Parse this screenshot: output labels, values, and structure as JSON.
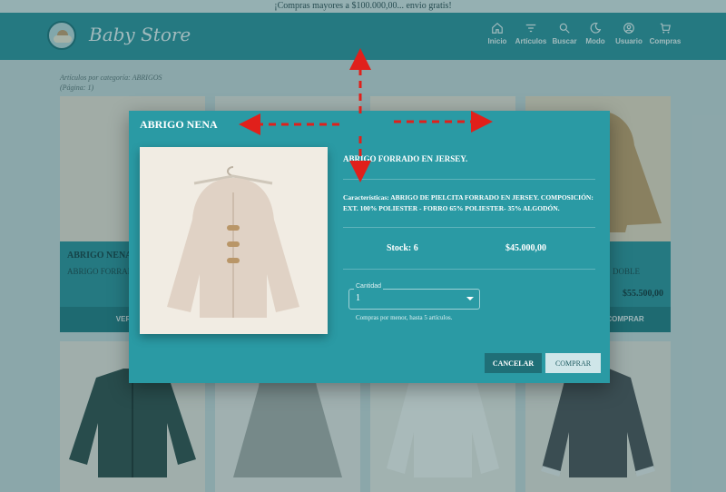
{
  "promo_banner": "¡Compras mayores a $100.000,00... envio gratis!",
  "brand": {
    "name": "Baby Store",
    "logo": "bear-cloud-logo"
  },
  "nav": [
    {
      "label": "Inicio",
      "icon": "home-icon"
    },
    {
      "label": "Artículos",
      "icon": "filter-icon"
    },
    {
      "label": "Buscar",
      "icon": "search-icon"
    },
    {
      "label": "Modo",
      "icon": "moon-icon"
    },
    {
      "label": "Usuario",
      "icon": "user-icon"
    },
    {
      "label": "Compras",
      "icon": "cart-icon"
    }
  ],
  "breadcrumb": {
    "category": "Artículos por categoría: ABRIGOS",
    "page": "(Página: 1)"
  },
  "cards": [
    {
      "title": "ABRIGO NENA",
      "subtitle": "ABRIGO FORRADO",
      "price": "",
      "button": "VER MÁS"
    },
    {
      "title": "",
      "subtitle": "",
      "price": "",
      "button": ""
    },
    {
      "title": "",
      "subtitle": "",
      "price": "",
      "button": ""
    },
    {
      "title": "",
      "subtitle": "DOBLE",
      "price": "$55.500,00",
      "button": "COMPRAR"
    }
  ],
  "modal": {
    "title": "ABRIGO NENA",
    "description": "ABRIGO FORRADO EN JERSEY.",
    "features": "Características: ABRIGO DE PIELCITA FORRADO EN JERSEY. COMPOSICIÓN: EXT. 100% POLIESTER - FORRO 65% POLIESTER- 35% ALGODÓN.",
    "stock": "Stock: 6",
    "price": "$45.000,00",
    "quantity": {
      "label": "Cantidad",
      "value": "1"
    },
    "helper": "Compras por menor, hasta 5 artículos.",
    "cancel_label": "CANCELAR",
    "buy_label": "COMPRAR"
  },
  "colors": {
    "teal": "#2a8f98",
    "modal": "#2a9aa4",
    "dark_teal": "#1f6f77",
    "annotation_arrow": "#e0201b"
  }
}
